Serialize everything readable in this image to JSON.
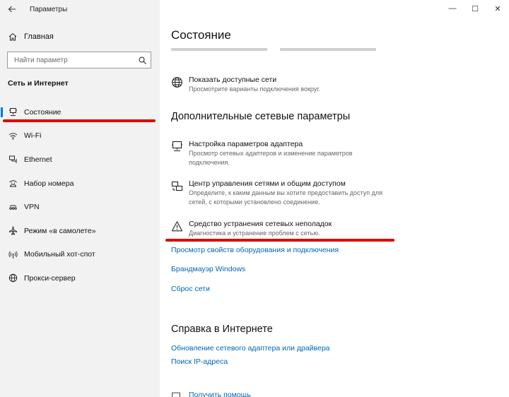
{
  "window": {
    "title": "Параметры",
    "back_icon": "back-arrow-icon",
    "controls": [
      "—",
      "☐",
      "✕"
    ]
  },
  "sidebar": {
    "home_label": "Главная",
    "search_placeholder": "Найти параметр",
    "section_title": "Сеть и Интернет",
    "items": [
      {
        "label": "Состояние",
        "icon": "status-icon",
        "active": true
      },
      {
        "label": "Wi-Fi",
        "icon": "wifi-icon"
      },
      {
        "label": "Ethernet",
        "icon": "ethernet-icon"
      },
      {
        "label": "Набор номера",
        "icon": "dialup-icon"
      },
      {
        "label": "VPN",
        "icon": "vpn-icon"
      },
      {
        "label": "Режим «в самолете»",
        "icon": "airplane-icon"
      },
      {
        "label": "Мобильный хот-спот",
        "icon": "hotspot-icon"
      },
      {
        "label": "Прокси-сервер",
        "icon": "proxy-icon"
      }
    ]
  },
  "main": {
    "title": "Состояние",
    "show_networks": {
      "title": "Показать доступные сети",
      "desc": "Просмотрите варианты подключения вокруг."
    },
    "advanced_heading": "Дополнительные сетевые параметры",
    "adapter": {
      "title": "Настройка параметров адаптера",
      "desc": "Просмотр сетевых адаптеров и изменение параметров подключения."
    },
    "sharing_center": {
      "title": "Центр управления сетями и общим доступом",
      "desc": "Определите, к каким данным вы хотите предоставить доступ для сетей, с которыми установлено соединение."
    },
    "troubleshooter": {
      "title": "Средство устранения сетевых неполадок",
      "desc": "Диагностика и устранение проблем с сетью."
    },
    "links": [
      "Просмотр свойств оборудования и подключения",
      "Брандмауэр Windows",
      "Сброс сети"
    ],
    "help_heading": "Справка в Интернете",
    "help_links": [
      "Обновление сетевого адаптера или драйвера",
      "Поиск IP-адреса"
    ],
    "get_help": "Получить помощь"
  },
  "colors": {
    "accent": "#0078d7",
    "link": "#0066b4",
    "annotation": "#e00000",
    "sidebar_bg": "#f2f2f2"
  }
}
